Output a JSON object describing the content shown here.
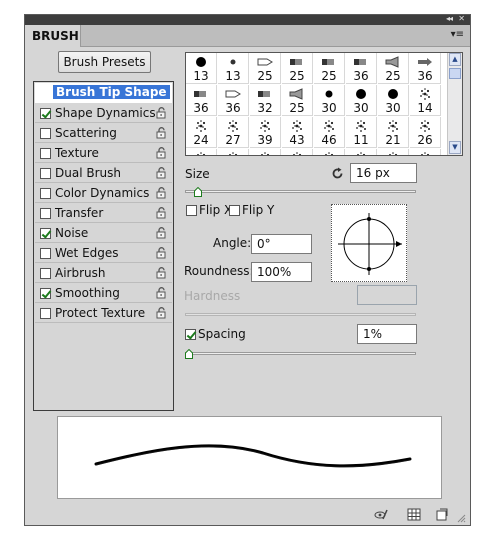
{
  "panel": {
    "tab": "BRUSH",
    "collapse_glyph": "◂◂",
    "close_glyph": "✕",
    "menu_glyph": "▾≡"
  },
  "toolbar": {
    "brush_presets_label": "Brush Presets"
  },
  "options": {
    "header": "Brush Tip Shape",
    "items": [
      {
        "label": "Shape Dynamics",
        "checked": true,
        "icon": "lock-icon"
      },
      {
        "label": "Scattering",
        "checked": false,
        "icon": "lock-icon"
      },
      {
        "label": "Texture",
        "checked": false,
        "icon": "lock-icon"
      },
      {
        "label": "Dual Brush",
        "checked": false,
        "icon": "lock-icon"
      },
      {
        "label": "Color Dynamics",
        "checked": false,
        "icon": "lock-icon"
      },
      {
        "label": "Transfer",
        "checked": false,
        "icon": "lock-icon"
      },
      {
        "label": "Noise",
        "checked": true,
        "icon": "lock-icon"
      },
      {
        "label": "Wet Edges",
        "checked": false,
        "icon": "lock-icon"
      },
      {
        "label": "Airbrush",
        "checked": false,
        "icon": "lock-icon"
      },
      {
        "label": "Smoothing",
        "checked": true,
        "icon": "lock-icon"
      },
      {
        "label": "Protect Texture",
        "checked": false,
        "icon": "lock-icon"
      }
    ]
  },
  "brush_tips": {
    "rows": [
      [
        "13",
        "13",
        "25",
        "25",
        "25",
        "36",
        "25",
        "36"
      ],
      [
        "36",
        "36",
        "32",
        "25",
        "30",
        "30",
        "30",
        "14"
      ],
      [
        "24",
        "27",
        "39",
        "43",
        "46",
        "11",
        "21",
        "26"
      ],
      [
        "",
        "",
        "",
        "",
        "",
        "",
        "",
        ""
      ]
    ]
  },
  "tip_settings": {
    "size_label": "Size",
    "size_value": "16 px",
    "size_fraction": 0.04,
    "flip_x_label": "Flip X",
    "flip_y_label": "Flip Y",
    "angle_label": "Angle:",
    "angle_value": "0°",
    "roundness_label": "Roundness:",
    "roundness_value": "100%",
    "hardness_label": "Hardness",
    "hardness_value": "",
    "spacing_label": "Spacing",
    "spacing_value": "1%",
    "spacing_checked": true,
    "spacing_fraction": 0.0
  },
  "bottom_icons": [
    "eye-brush-icon",
    "grid-icon",
    "new-preset-icon"
  ],
  "colors": {
    "accent": "#3875d7",
    "check": "#1d7b1d",
    "panel_bg": "#d6d6d6"
  }
}
